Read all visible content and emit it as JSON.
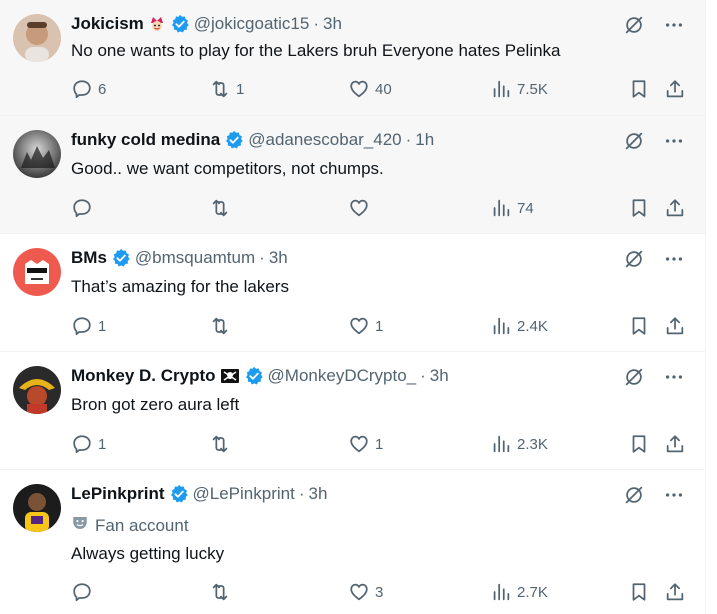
{
  "colors": {
    "verified": "#1d9bf0",
    "muted": "#536471",
    "text": "#0f1419",
    "hover_bg": "#f7f7f7"
  },
  "tweets": [
    {
      "name": "Jokicism",
      "handle": "@jokicgoatic15",
      "separator": "·",
      "time": "3h",
      "text": "No one wants to play for the Lakers bruh Everyone hates Pelinka",
      "replies": "6",
      "retweets": "1",
      "likes": "40",
      "views": "7.5K"
    },
    {
      "name": "funky cold medina",
      "handle": "@adanescobar_420",
      "separator": "·",
      "time": "1h",
      "text": "Good.. we want competitors, not chumps.",
      "replies": "",
      "retweets": "",
      "likes": "",
      "views": "74"
    },
    {
      "name": "BMs",
      "handle": "@bmsquamtum",
      "separator": "·",
      "time": "3h",
      "text": "That’s amazing for the lakers",
      "replies": "1",
      "retweets": "",
      "likes": "1",
      "views": "2.4K"
    },
    {
      "name": "Monkey D. Crypto",
      "handle": "@MonkeyDCrypto_",
      "separator": "·",
      "time": "3h",
      "text": "Bron got zero aura left",
      "replies": "1",
      "retweets": "",
      "likes": "1",
      "views": "2.3K"
    },
    {
      "name": "LePinkprint",
      "handle": "@LePinkprint",
      "separator": "·",
      "time": "3h",
      "label": "Fan account",
      "text": "Always getting lucky",
      "replies": "",
      "retweets": "",
      "likes": "3",
      "views": "2.7K"
    }
  ]
}
